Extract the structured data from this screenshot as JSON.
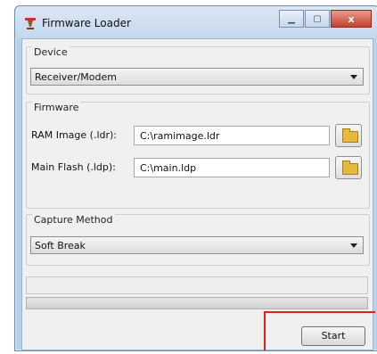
{
  "window": {
    "title": "Firmware Loader",
    "icon": "firmware-loader-icon"
  },
  "caption_buttons": {
    "minimize": "minimize-icon",
    "maximize": "maximize-icon",
    "close_glyph": "x"
  },
  "device": {
    "legend": "Device",
    "selected": "Receiver/Modem"
  },
  "firmware": {
    "legend": "Firmware",
    "ram_label": "RAM Image (.ldr):",
    "ram_value": "C:\\ramimage.ldr",
    "flash_label": "Main Flash (.ldp):",
    "flash_value": "C:\\main.ldp"
  },
  "capture": {
    "legend": "Capture Method",
    "selected": "Soft Break"
  },
  "progress": {
    "value": 0
  },
  "actions": {
    "start_label": "Start"
  },
  "colors": {
    "highlight": "#e02020",
    "folder": "#e7b93a"
  }
}
